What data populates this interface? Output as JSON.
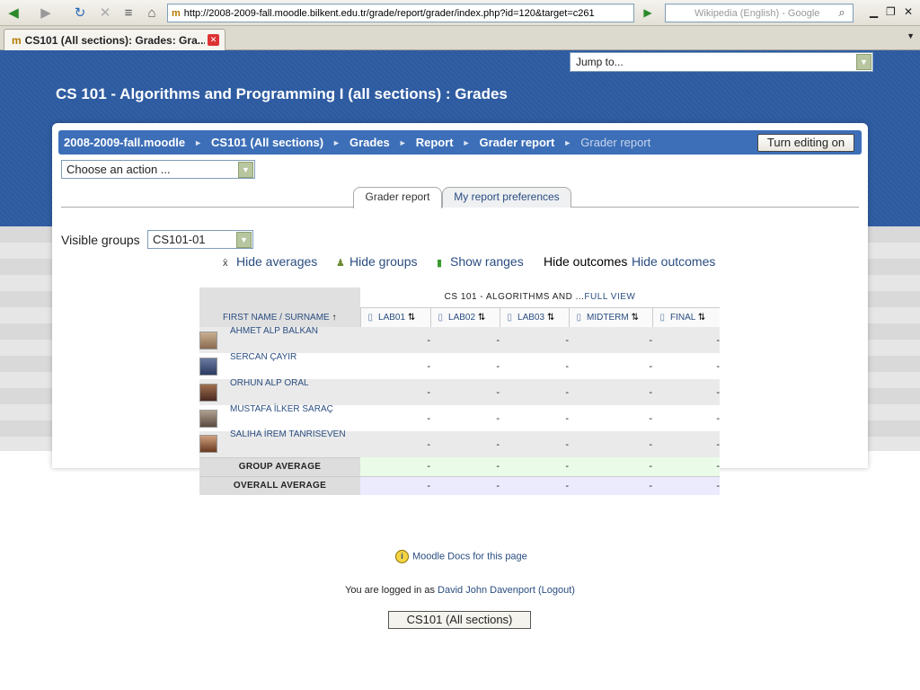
{
  "browser": {
    "url": "http://2008-2009-fall.moodle.bilkent.edu.tr/grade/report/grader/index.php?id=120&target=c261",
    "search_placeholder": "Wikipedia (English) - Google",
    "tab_title": "CS101 (All sections): Grades: Gra...",
    "tab_favicon_letter": "m"
  },
  "header": {
    "jump_to": "Jump to...",
    "title": "CS 101 - Algorithms and Programming I (all sections) : Grades"
  },
  "breadcrumb": {
    "items": [
      "2008-2009-fall.moodle",
      "CS101 (All sections)",
      "Grades",
      "Report",
      "Grader report"
    ],
    "current": "Grader report",
    "separator": "►"
  },
  "editing_button": "Turn editing on",
  "action_select": "Choose an action ...",
  "tabs": [
    "Grader report",
    "My report preferences"
  ],
  "groups": {
    "label": "Visible groups",
    "selected": "CS101-01"
  },
  "toggles": {
    "averages": "Hide averages",
    "groups": "Hide groups",
    "ranges": "Show ranges",
    "outcomes_static": "Hide outcomes",
    "outcomes_link": "Hide outcomes"
  },
  "table": {
    "category_header": "CS 101 - ALGORITHMS AND ...",
    "full_view": "FULL VIEW",
    "name_header": "FIRST NAME / SURNAME",
    "columns": [
      "LAB01",
      "LAB02",
      "LAB03",
      "MIDTERM",
      "FINAL"
    ],
    "students": [
      {
        "name": "AHMET ALP BALKAN",
        "grades": [
          "-",
          "-",
          "-",
          "-",
          "-"
        ]
      },
      {
        "name": "SERCAN ÇAYIR",
        "grades": [
          "-",
          "-",
          "-",
          "-",
          "-"
        ]
      },
      {
        "name": "ORHUN ALP ORAL",
        "grades": [
          "-",
          "-",
          "-",
          "-",
          "-"
        ]
      },
      {
        "name": "MUSTAFA İLKER SARAÇ",
        "grades": [
          "-",
          "-",
          "-",
          "-",
          "-"
        ]
      },
      {
        "name": "SALIHA İREM TANRISEVEN",
        "grades": [
          "-",
          "-",
          "-",
          "-",
          "-"
        ]
      }
    ],
    "group_average": {
      "label": "GROUP AVERAGE",
      "values": [
        "-",
        "-",
        "-",
        "-",
        "-"
      ]
    },
    "overall_average": {
      "label": "OVERALL AVERAGE",
      "values": [
        "-",
        "-",
        "-",
        "-",
        "-"
      ]
    }
  },
  "footer": {
    "docs_link": "Moodle Docs for this page",
    "logged_in_prefix": "You are logged in as",
    "user_name": "David John Davenport",
    "logout": "(Logout)",
    "course_button": "CS101 (All sections)"
  }
}
